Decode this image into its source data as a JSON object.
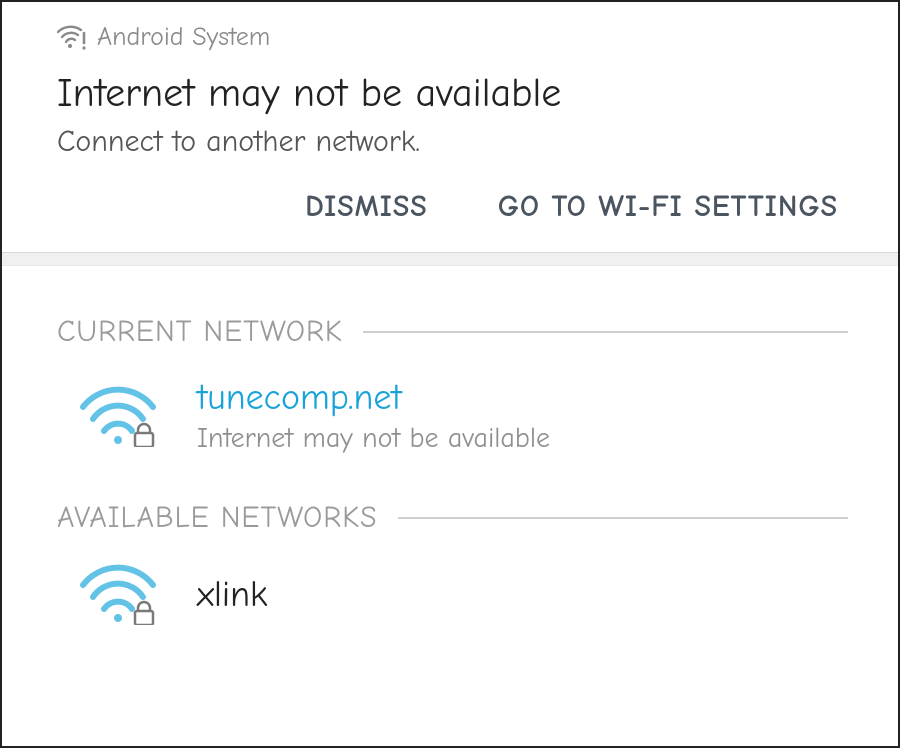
{
  "notification": {
    "source": "Android System",
    "title": "Internet may not be available",
    "subtitle": "Connect to another network.",
    "actions": {
      "dismiss": "DISMISS",
      "settings": "GO TO WI-FI SETTINGS"
    }
  },
  "sections": {
    "current_label": "CURRENT NETWORK",
    "available_label": "AVAILABLE NETWORKS"
  },
  "current_network": {
    "name": "tunecomp.net",
    "status": "Internet may not be available"
  },
  "available_networks": [
    {
      "name": "xlink"
    }
  ]
}
